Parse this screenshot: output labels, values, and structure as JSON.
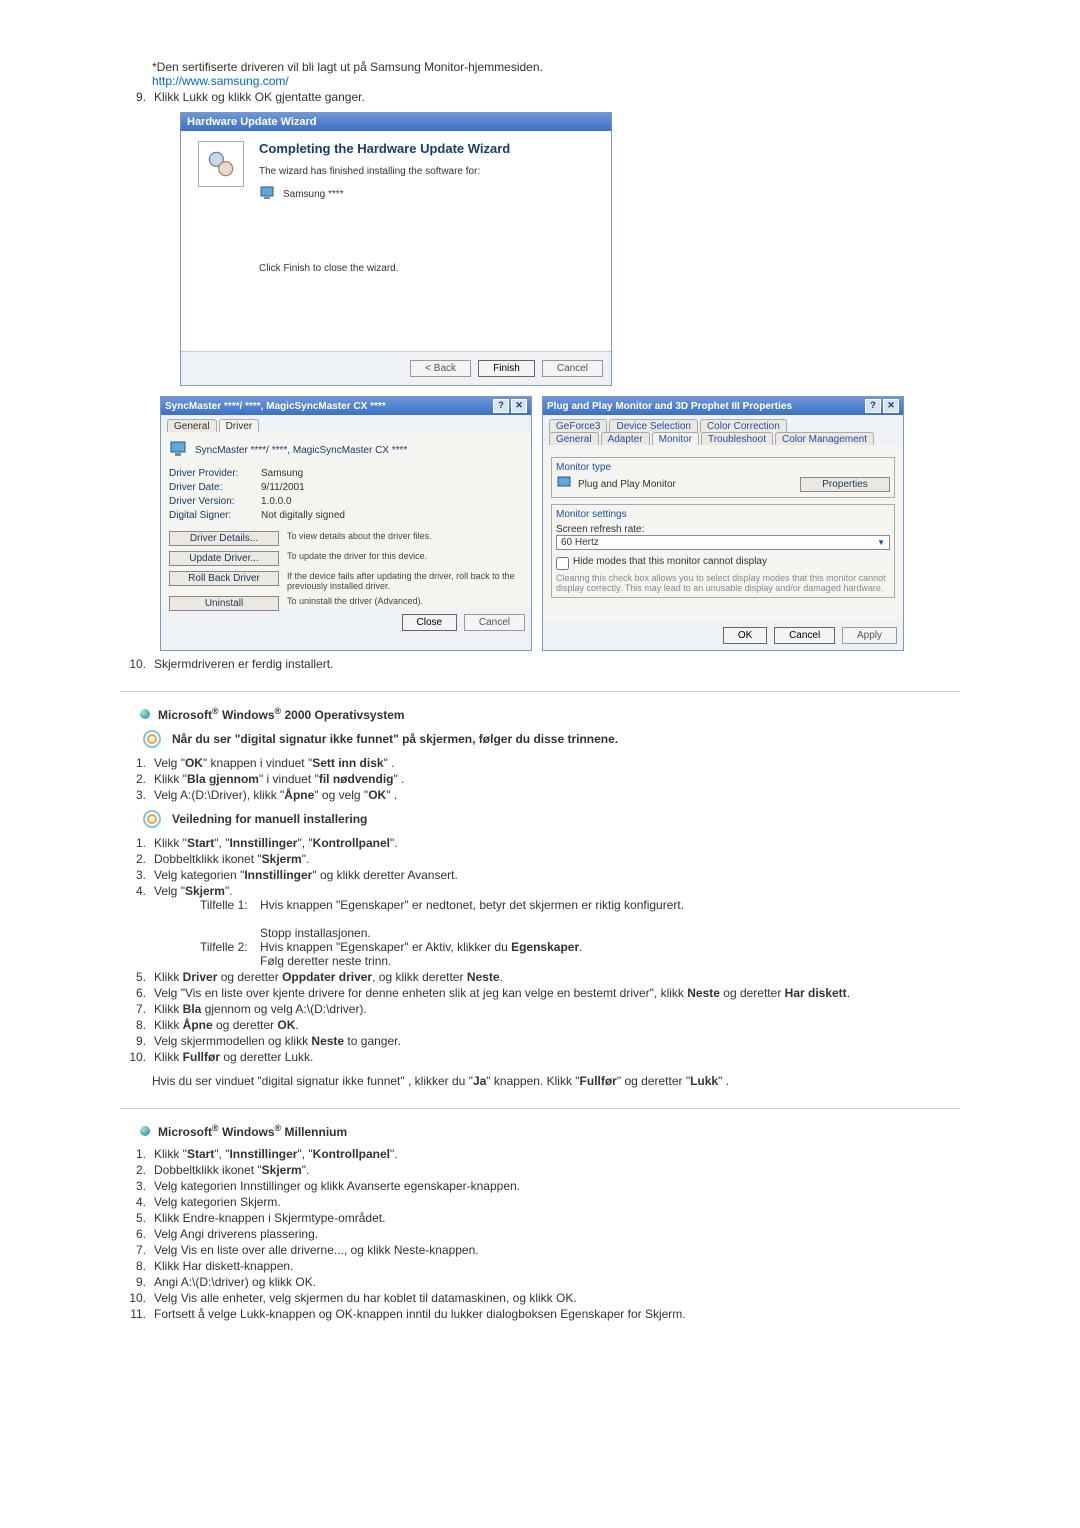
{
  "intro": {
    "cert_line": "*Den sertifiserte driveren vil bli lagt ut på Samsung Monitor-hjemmesiden.",
    "url": "http://www.samsung.com/",
    "step9_num": "9.",
    "step9_text": "Klikk Lukk og klikk OK gjentatte ganger."
  },
  "wizard": {
    "title": "Hardware Update Wizard",
    "heading": "Completing the Hardware Update Wizard",
    "sub1": "The wizard has finished installing the software for:",
    "sub2": "Samsung ****",
    "finish_hint": "Click Finish to close the wizard.",
    "btn_back": "< Back",
    "btn_finish": "Finish",
    "btn_cancel": "Cancel"
  },
  "driver_dlg": {
    "title": "SyncMaster ****/ ****, MagicSyncMaster CX ****",
    "tab_general": "General",
    "tab_driver": "Driver",
    "name": "SyncMaster ****/ ****, MagicSyncMaster CX ****",
    "rows": [
      {
        "label": "Driver Provider:",
        "value": "Samsung"
      },
      {
        "label": "Driver Date:",
        "value": "9/11/2001"
      },
      {
        "label": "Driver Version:",
        "value": "1.0.0.0"
      },
      {
        "label": "Digital Signer:",
        "value": "Not digitally signed"
      }
    ],
    "btns": [
      {
        "label": "Driver Details...",
        "desc": "To view details about the driver files."
      },
      {
        "label": "Update Driver...",
        "desc": "To update the driver for this device."
      },
      {
        "label": "Roll Back Driver",
        "desc": "If the device fails after updating the driver, roll back to the previously installed driver."
      },
      {
        "label": "Uninstall",
        "desc": "To uninstall the driver (Advanced)."
      }
    ],
    "btn_close": "Close",
    "btn_cancel": "Cancel"
  },
  "prop_dlg": {
    "title": "Plug and Play Monitor and 3D Prophet III Properties",
    "tabs_row1": [
      "GeForce3",
      "Device Selection",
      "Color Correction"
    ],
    "tabs_row2": [
      "General",
      "Adapter",
      "Monitor",
      "Troubleshoot",
      "Color Management"
    ],
    "group_monitor_type": "Monitor type",
    "monitor_name": "Plug and Play Monitor",
    "btn_properties": "Properties",
    "group_settings": "Monitor settings",
    "label_refresh": "Screen refresh rate:",
    "refresh_value": "60 Hertz",
    "hide_label": "Hide modes that this monitor cannot display",
    "hide_desc": "Clearing this check box allows you to select display modes that this monitor cannot display correctly. This may lead to an unusable display and/or damaged hardware.",
    "btn_ok": "OK",
    "btn_cancel": "Cancel",
    "btn_apply": "Apply"
  },
  "step10": {
    "num": "10.",
    "text": "Skjermdriveren er ferdig installert."
  },
  "win2000": {
    "heading_pre": "Microsoft",
    "heading_mid": " Windows",
    "heading_post": " 2000 Operativsystem",
    "sig_heading": "Når du ser \"digital signatur ikke funnet\" på skjermen, følger du disse trinnene.",
    "sig_steps": [
      {
        "n": "1.",
        "t": "Velg \"<b>OK</b>\" knappen i vinduet \"<b>Sett inn disk</b>\" ."
      },
      {
        "n": "2.",
        "t": "Klikk \"<b>Bla gjennom</b>\" i vinduet \"<b>fil nødvendig</b>\" ."
      },
      {
        "n": "3.",
        "t": "Velg A:(D:\\Driver), klikk \"<b>Åpne</b>\" og velg \"<b>OK</b>\" ."
      }
    ],
    "manual_heading": "Veiledning for manuell installering",
    "manual_steps_a": [
      {
        "n": "1.",
        "t": "Klikk \"<b>Start</b>\", \"<b>Innstillinger</b>\", \"<b>Kontrollpanel</b>\"."
      },
      {
        "n": "2.",
        "t": "Dobbeltklikk ikonet \"<b>Skjerm</b>\"."
      },
      {
        "n": "3.",
        "t": "Velg kategorien \"<b>Innstillinger</b>\" og klikk deretter Avansert."
      },
      {
        "n": "4.",
        "t": "Velg \"<b>Skjerm</b>\"."
      }
    ],
    "case1_label": "Tilfelle 1:",
    "case1_text": "Hvis knappen \"Egenskaper\" er nedtonet, betyr det skjermen er riktig konfigurert.",
    "case1_stop": "Stopp installasjonen.",
    "case2_label": "Tilfelle 2:",
    "case2_text": "Hvis knappen \"Egenskaper\" er Aktiv, klikker du <b>Egenskaper</b>.",
    "case2_follow": "Følg deretter neste trinn.",
    "manual_steps_b": [
      {
        "n": "5.",
        "t": "Klikk <b>Driver</b> og deretter <b>Oppdater driver</b>, og klikk deretter <b>Neste</b>."
      },
      {
        "n": "6.",
        "t": "Velg \"Vis en liste over kjente drivere for denne enheten slik at jeg kan velge en bestemt driver\", klikk <b>Neste</b> og deretter <b>Har diskett</b>."
      },
      {
        "n": "7.",
        "t": "Klikk <b>Bla</b> gjennom og velg A:\\(D:\\driver)."
      },
      {
        "n": "8.",
        "t": "Klikk <b>Åpne</b> og deretter <b>OK</b>."
      },
      {
        "n": "9.",
        "t": "Velg skjermmodellen og klikk <b>Neste</b> to ganger."
      },
      {
        "n": "10.",
        "t": "Klikk <b>Fullfør</b> og deretter Lukk."
      }
    ],
    "note": "Hvis du ser vinduet \"digital signatur ikke funnet\" , klikker du \"<b>Ja</b>\" knappen. Klikk \"<b>Fullfør</b>\" og deretter \"<b>Lukk</b>\" ."
  },
  "winme": {
    "heading_pre": "Microsoft",
    "heading_mid": " Windows",
    "heading_post": " Millennium",
    "steps": [
      {
        "n": "1.",
        "t": "Klikk \"<b>Start</b>\", \"<b>Innstillinger</b>\", \"<b>Kontrollpanel</b>\"."
      },
      {
        "n": "2.",
        "t": "Dobbeltklikk ikonet \"<b>Skjerm</b>\"."
      },
      {
        "n": "3.",
        "t": "Velg kategorien Innstillinger og klikk Avanserte egenskaper-knappen."
      },
      {
        "n": "4.",
        "t": "Velg kategorien Skjerm."
      },
      {
        "n": "5.",
        "t": "Klikk Endre-knappen i Skjermtype-området."
      },
      {
        "n": "6.",
        "t": "Velg Angi driverens plassering."
      },
      {
        "n": "7.",
        "t": "Velg Vis en liste over alle driverne..., og klikk Neste-knappen."
      },
      {
        "n": "8.",
        "t": "Klikk Har diskett-knappen."
      },
      {
        "n": "9.",
        "t": "Angi A:\\(D:\\driver) og klikk OK."
      },
      {
        "n": "10.",
        "t": "Velg Vis alle enheter, velg skjermen du har koblet til datamaskinen, og klikk OK."
      },
      {
        "n": "11.",
        "t": "Fortsett å velge Lukk-knappen og OK-knappen inntil du lukker dialogboksen Egenskaper for Skjerm."
      }
    ]
  }
}
